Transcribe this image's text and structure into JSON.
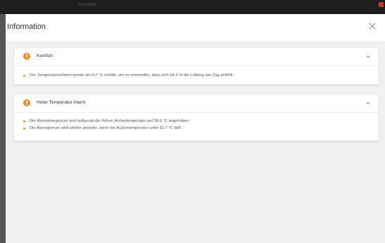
{
  "app_bar": {
    "title": "Hersteller"
  },
  "dialog": {
    "title": "Information",
    "close_icon": "close-icon"
  },
  "accent_color": "#f08a24",
  "cards": [
    {
      "title": "Komfort",
      "icon": "info-icon",
      "expanded": true,
      "lines": [
        "Der Temperatursollwert wurde um 0,7 °C erhöht, um zu vermeiden, dass sich 54,2 % die Lüftung wie Zug anfühlt"
      ]
    },
    {
      "title": "Hohe Temperatur Alarm",
      "icon": "info-icon",
      "expanded": true,
      "lines": [
        "Die Alarmobergrenze wird aufgrund der hohen Außentemperatur auf 28,0 °C angehoben",
        "Die Alarmgrenze wird wieder gesenkt, wenn die Außentemperatur unter 11,7 °C fällt"
      ]
    }
  ]
}
